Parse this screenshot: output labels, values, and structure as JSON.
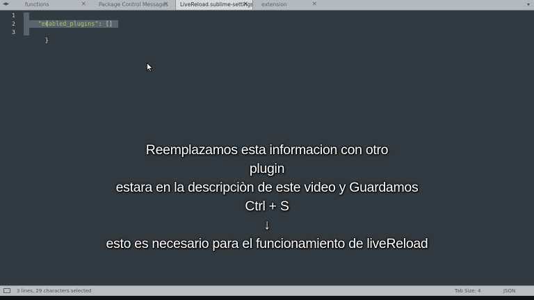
{
  "tabs": [
    {
      "label": "functions",
      "active": false
    },
    {
      "label": "Package Control Messages",
      "active": false
    },
    {
      "label": "LiveReload.sublime-settings",
      "active": true
    },
    {
      "label": "extension",
      "active": false
    }
  ],
  "tab_close_glyph": "×",
  "tab_nav_glyph": "◂▸",
  "tab_overflow_glyph": "▾",
  "line_numbers": [
    "1",
    "2",
    "3"
  ],
  "code": {
    "line1": "{",
    "line2_key": "\"enabled_plugins\"",
    "line2_rest": ": []",
    "line3": "}"
  },
  "caption": {
    "line1": "Reemplazamos esta informacion con otro",
    "line2": "plugin",
    "line3": "estara en la descripciòn de este video  y Guardamos",
    "line4": "Ctrl + S",
    "line5": "↓",
    "line6": "esto es necesario para el funcionamiento de liveReload"
  },
  "statusbar": {
    "selection": "3 lines, 29 characters selected",
    "tab_size": "Tab Size: 4",
    "syntax": "JSON"
  },
  "colors": {
    "editor_bg": "#313a40",
    "string": "#9fc46a",
    "selection": "#58636a"
  }
}
